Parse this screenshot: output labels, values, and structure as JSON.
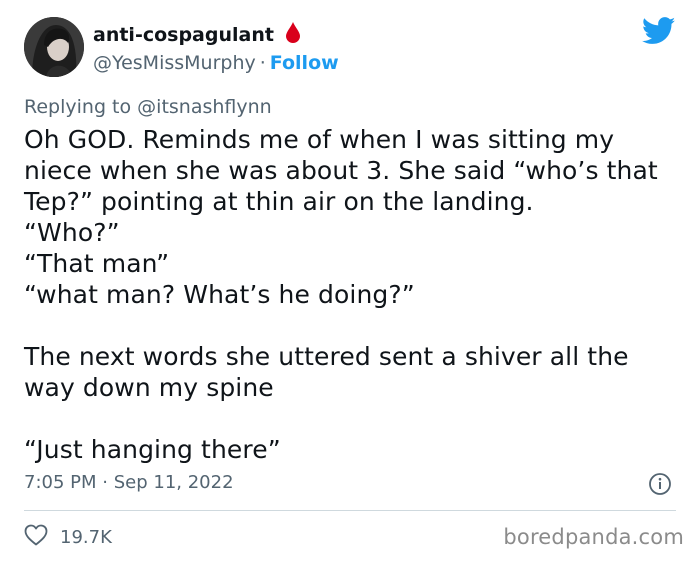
{
  "author": {
    "display_name": "anti-cospagulant",
    "handle": "@YesMissMurphy",
    "separator": "·",
    "follow_label": "Follow",
    "verified_icon": "blood-drop-icon",
    "accent": "#d9001b"
  },
  "platform_icon": "twitter-bird-icon",
  "reply": {
    "prefix": "Replying to",
    "mention": "@itsnashflynn"
  },
  "tweet": {
    "text": "Oh GOD. Reminds me of when I was sitting my\nniece when she was about 3. She said “who’s that\nTep?” pointing at thin air on the landing.\n“Who?”\n“That man”\n“what man? What’s he doing?”\n\nThe next words she uttered sent a shiver all the\nway down my spine\n\n“Just hanging there”"
  },
  "meta": {
    "time": "7:05 PM",
    "separator": "·",
    "date": "Sep 11, 2022"
  },
  "engagement": {
    "likes": "19.7K",
    "like_icon": "heart-outline-icon"
  },
  "watermark": "boredpanda.com",
  "colors": {
    "link": "#1d9bf0",
    "secondary_text": "#536471",
    "divider": "#cfd9de"
  }
}
